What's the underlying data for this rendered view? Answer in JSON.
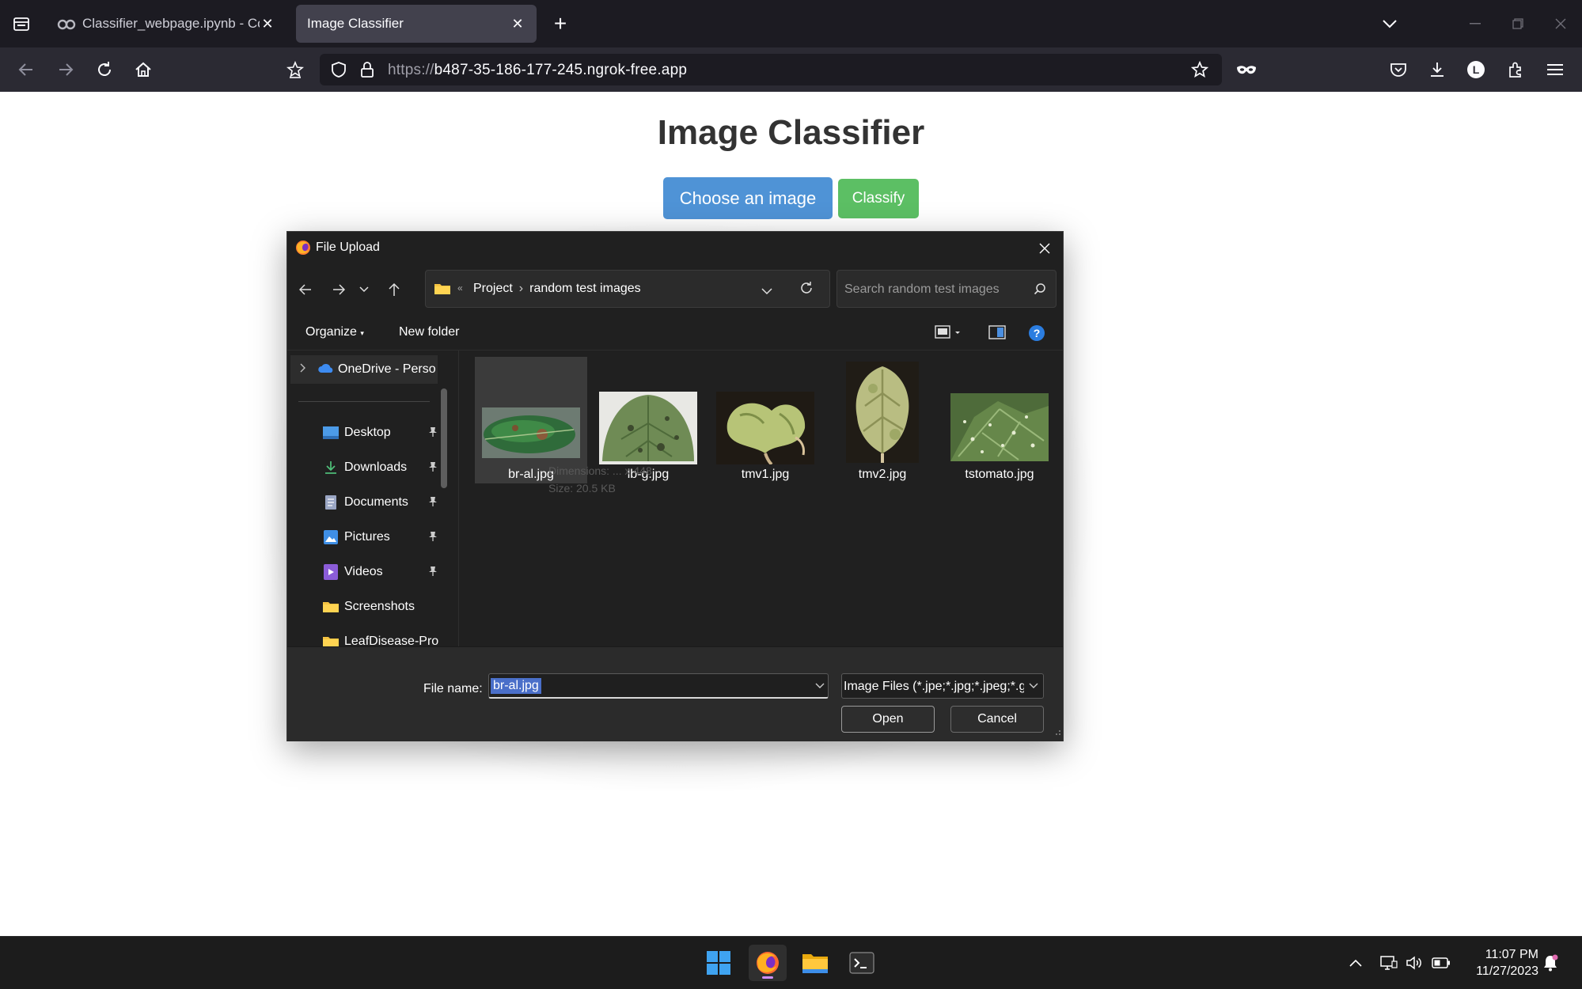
{
  "browser": {
    "tabs": [
      {
        "title": "Classifier_webpage.ipynb - Cola",
        "active": false
      },
      {
        "title": "Image Classifier",
        "active": true
      }
    ],
    "url_scheme": "https://",
    "url_host": "b487-35-186-177-245.ngrok-free.app",
    "profile_initial": "L"
  },
  "page": {
    "title": "Image Classifier",
    "choose_button": "Choose an image",
    "classify_button": "Classify",
    "choose_color": "#4f93d6",
    "classify_color": "#5cbf64"
  },
  "dialog": {
    "title": "File Upload",
    "breadcrumb": [
      "Project",
      "random test images"
    ],
    "breadcrumb_overflow": "«",
    "search_placeholder": "Search random test images",
    "organize_label": "Organize",
    "new_folder_label": "New folder",
    "sidebar": {
      "onedrive": "OneDrive - Perso",
      "items": [
        {
          "label": "Desktop",
          "icon": "desktop-icon",
          "pinned": true
        },
        {
          "label": "Downloads",
          "icon": "download-icon",
          "pinned": true
        },
        {
          "label": "Documents",
          "icon": "document-icon",
          "pinned": true
        },
        {
          "label": "Pictures",
          "icon": "pictures-icon",
          "pinned": true
        },
        {
          "label": "Videos",
          "icon": "videos-icon",
          "pinned": true
        },
        {
          "label": "Screenshots",
          "icon": "folder-icon",
          "pinned": false
        },
        {
          "label": "LeafDisease-Pro",
          "icon": "folder-icon",
          "pinned": false
        }
      ]
    },
    "files": [
      {
        "name": "br-al.jpg",
        "selected": true
      },
      {
        "name": "lb-g.jpg",
        "selected": false
      },
      {
        "name": "tmv1.jpg",
        "selected": false
      },
      {
        "name": "tmv2.jpg",
        "selected": false
      },
      {
        "name": "tstomato.jpg",
        "selected": false
      }
    ],
    "tooltip_ghost": [
      "Dimensions: ... x 448",
      "Size: 20.5 KB"
    ],
    "filename_label": "File name:",
    "filename_value": "br-al.jpg",
    "filetype_value": "Image Files (*.jpe;*.jpg;*.jpeg;*.gif;*.png)",
    "open_button": "Open",
    "cancel_button": "Cancel"
  },
  "taskbar": {
    "time": "11:07 PM",
    "date": "11/27/2023"
  }
}
